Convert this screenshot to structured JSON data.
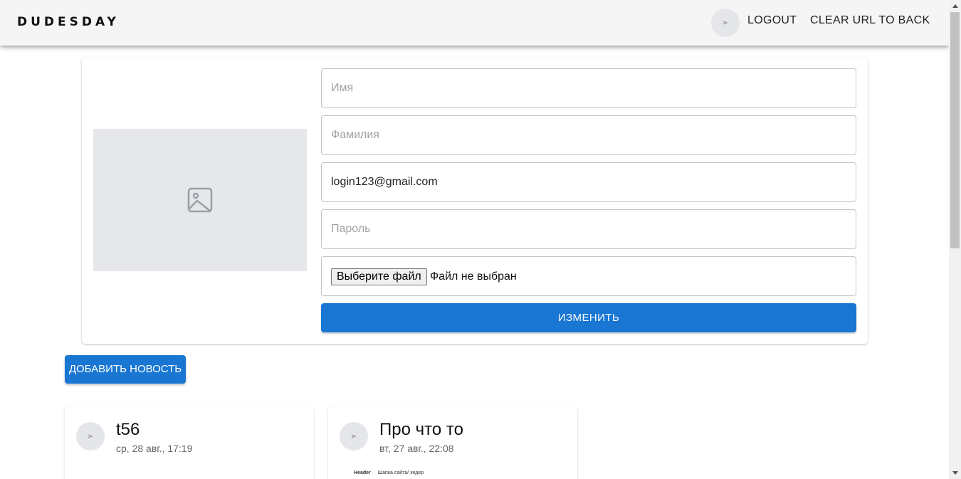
{
  "header": {
    "brand": "DUDESDAY",
    "logout_label": "LOGOUT",
    "clear_label": "CLEAR URL TO BACK"
  },
  "profile_form": {
    "first_name": {
      "value": "",
      "placeholder": "Имя"
    },
    "last_name": {
      "value": "",
      "placeholder": "Фамилия"
    },
    "email": {
      "value": "login123@gmail.com",
      "placeholder": ""
    },
    "password": {
      "value": "",
      "placeholder": "Пароль"
    },
    "file_button_label": "Выберите файл",
    "file_status": "Файл не выбран",
    "submit_label": "ИЗМЕНИТЬ"
  },
  "add_news_label": "ДОБАВИТЬ НОВОСТЬ",
  "news": [
    {
      "title": "t56",
      "date": "ср, 28 авг., 17:19"
    },
    {
      "title": "Про что то",
      "date": "вт, 27 авг., 22:08",
      "preview_heading": "Header",
      "preview_text": "Шапка сайта/ хедер"
    }
  ],
  "colors": {
    "primary": "#1976d2",
    "appbar": "#f5f5f5",
    "placeholder_bg": "#e5e7ea"
  },
  "icons": {
    "profile_photo": "image-icon",
    "avatar": "broken-image-icon"
  }
}
